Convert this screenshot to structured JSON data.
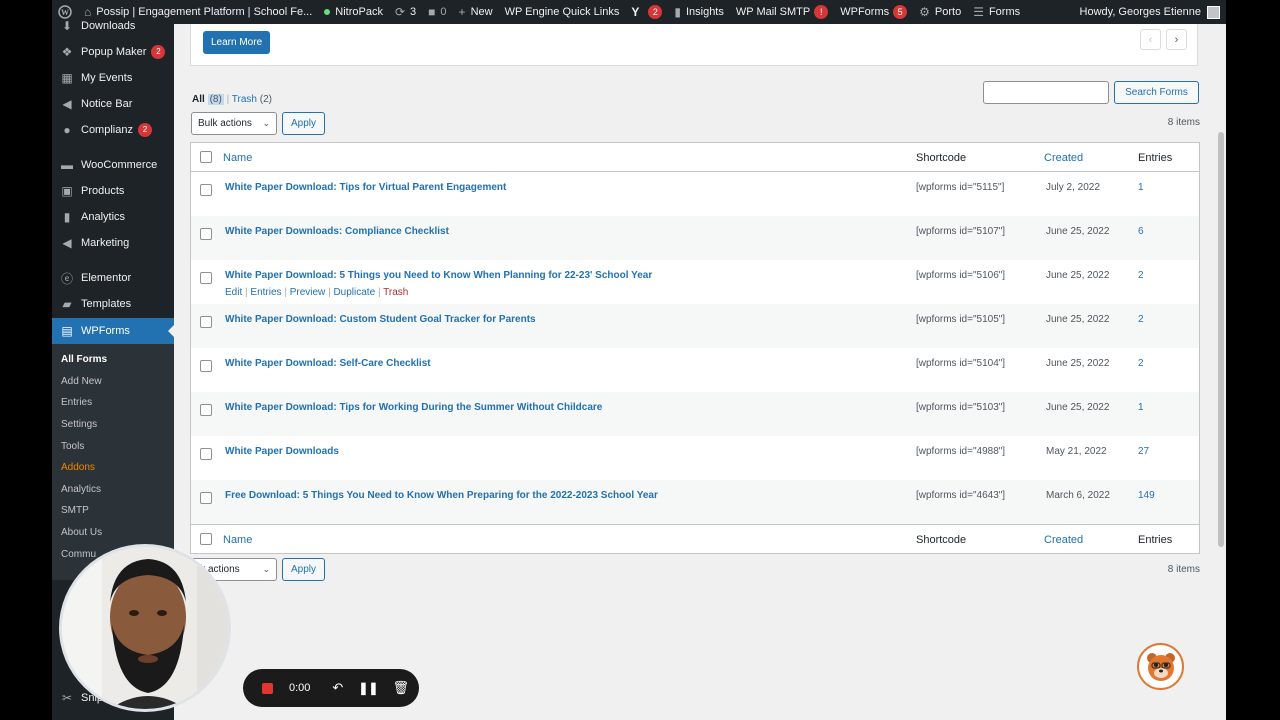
{
  "adminbar": {
    "site_name": "Possip | Engagement Platform | School Fe...",
    "nitropack": "NitroPack",
    "updates_count": "3",
    "comments_count": "0",
    "new_label": "New",
    "wp_engine": "WP Engine Quick Links",
    "yoast_badge": "2",
    "insights": "Insights",
    "wp_mail_smtp": "WP Mail SMTP",
    "wp_mail_badge": "!",
    "wpforms": "WPForms",
    "wpforms_badge": "5",
    "porto": "Porto",
    "forms": "Forms",
    "howdy": "Howdy, Georges Etienne"
  },
  "sidebar": {
    "items": [
      {
        "label": "Downloads",
        "icon": "download-icon"
      },
      {
        "label": "Popup Maker",
        "icon": "popup-icon",
        "badge": "2"
      },
      {
        "label": "My Events",
        "icon": "calendar-icon"
      },
      {
        "label": "Notice Bar",
        "icon": "megaphone-icon"
      },
      {
        "label": "Complianz",
        "icon": "complianz-icon",
        "badge": "2"
      },
      {
        "label": "WooCommerce",
        "icon": "woocommerce-icon"
      },
      {
        "label": "Products",
        "icon": "products-icon"
      },
      {
        "label": "Analytics",
        "icon": "bar-chart-icon"
      },
      {
        "label": "Marketing",
        "icon": "megaphone-icon"
      },
      {
        "label": "Elementor",
        "icon": "elementor-icon"
      },
      {
        "label": "Templates",
        "icon": "folder-icon"
      },
      {
        "label": "WPForms",
        "icon": "wpforms-icon"
      }
    ],
    "submenu": [
      "All Forms",
      "Add New",
      "Entries",
      "Settings",
      "Tools",
      "Addons",
      "Analytics",
      "SMTP",
      "About Us",
      "Commu"
    ],
    "partial": "Snip"
  },
  "notice": {
    "learn_more": "Learn More",
    "prev": "‹",
    "next": "›"
  },
  "views": {
    "all_label": "All",
    "all_count": "(8)",
    "separator": "|",
    "trash_label": "Trash",
    "trash_count": "(2)"
  },
  "search": {
    "button": "Search Forms",
    "value": ""
  },
  "bulk": {
    "label": "Bulk actions",
    "apply": "Apply",
    "items_count": "8 items"
  },
  "table": {
    "headers": {
      "name": "Name",
      "shortcode": "Shortcode",
      "created": "Created",
      "entries": "Entries"
    },
    "row_actions": {
      "edit": "Edit",
      "entries": "Entries",
      "preview": "Preview",
      "duplicate": "Duplicate",
      "trash": "Trash",
      "sep": "|"
    },
    "rows": [
      {
        "title": "White Paper Download: Tips for Virtual Parent Engagement",
        "shortcode": "[wpforms id=\"5115\"]",
        "created": "July 2, 2022",
        "entries": "1"
      },
      {
        "title": "White Paper Downloads: Compliance Checklist",
        "shortcode": "[wpforms id=\"5107\"]",
        "created": "June 25, 2022",
        "entries": "6"
      },
      {
        "title": "White Paper Download: 5 Things you Need to Know When Planning for 22-23' School Year",
        "shortcode": "[wpforms id=\"5106\"]",
        "created": "June 25, 2022",
        "entries": "2"
      },
      {
        "title": "White Paper Download: Custom Student Goal Tracker for Parents",
        "shortcode": "[wpforms id=\"5105\"]",
        "created": "June 25, 2022",
        "entries": "2"
      },
      {
        "title": "White Paper Download: Self-Care Checklist",
        "shortcode": "[wpforms id=\"5104\"]",
        "created": "June 25, 2022",
        "entries": "2"
      },
      {
        "title": "White Paper Download: Tips for Working During the Summer Without Childcare",
        "shortcode": "[wpforms id=\"5103\"]",
        "created": "June 25, 2022",
        "entries": "1"
      },
      {
        "title": "White Paper Downloads",
        "shortcode": "[wpforms id=\"4988\"]",
        "created": "May 21, 2022",
        "entries": "27"
      },
      {
        "title": "Free Download: 5 Things You Need to Know When Preparing for the 2022-2023 School Year",
        "shortcode": "[wpforms id=\"4643\"]",
        "created": "March 6, 2022",
        "entries": "149"
      }
    ]
  },
  "bottom_bulk": {
    "label": "lk actions",
    "apply": "Apply",
    "items_count": "8 items"
  },
  "recorder": {
    "time": "0:00"
  },
  "colors": {
    "admin_bar": "#1d2327",
    "accent": "#2271b1",
    "badge": "#d63638",
    "addons": "#f18500",
    "record": "#e5352f"
  }
}
